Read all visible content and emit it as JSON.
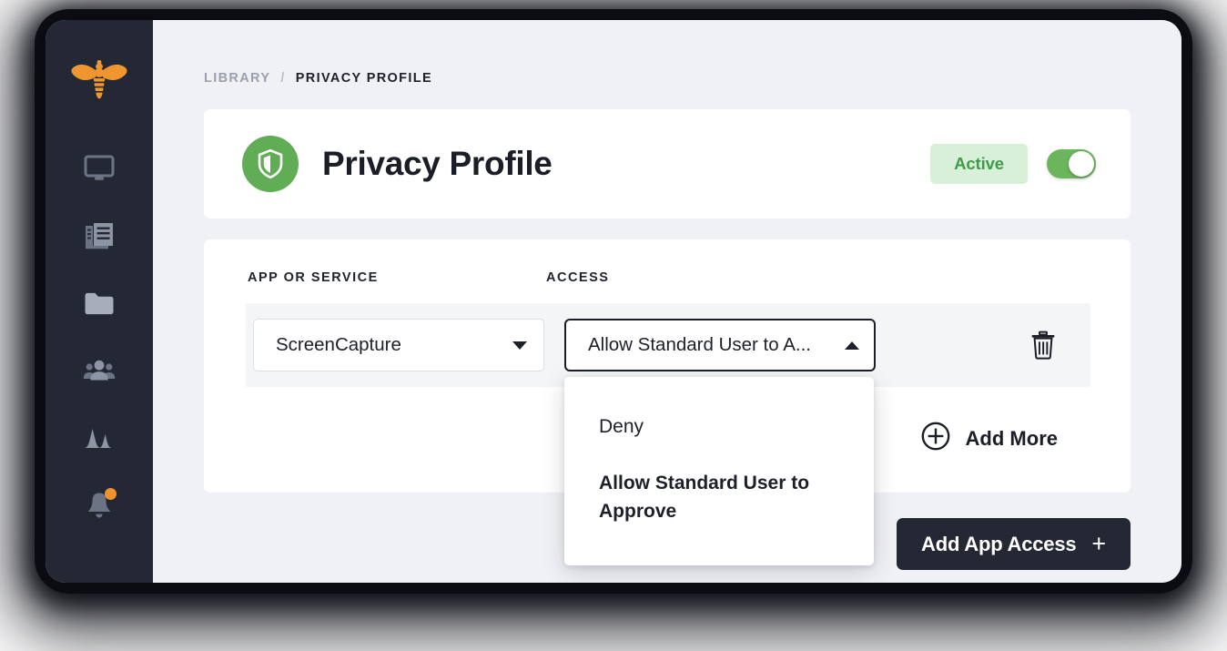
{
  "window": {
    "sidebar": {
      "logo_icon": "bee-logo",
      "items": [
        {
          "icon": "monitor-icon",
          "name": "devices"
        },
        {
          "icon": "documents-icon",
          "name": "library"
        },
        {
          "icon": "folder-icon",
          "name": "files"
        },
        {
          "icon": "people-icon",
          "name": "users"
        },
        {
          "icon": "activity-spikes-icon",
          "name": "activity"
        },
        {
          "icon": "bell-icon",
          "name": "notifications",
          "has_badge": true
        }
      ]
    },
    "breadcrumb": {
      "parent": "LIBRARY",
      "separator": "/",
      "current": "PRIVACY PROFILE"
    },
    "header_card": {
      "icon": "shield-icon",
      "icon_color": "#61ad55",
      "title": "Privacy Profile",
      "status_label": "Active",
      "status_bg": "#d9f0d8",
      "status_color": "#3f9b47",
      "toggle_on": true,
      "toggle_color": "#6bb65c"
    },
    "table": {
      "columns": {
        "app": "APP OR SERVICE",
        "access": "ACCESS"
      },
      "rows": [
        {
          "app_value": "ScreenCapture",
          "access_value": "Allow Standard User to A...",
          "access_expanded": true,
          "delete_icon": "trash-icon"
        }
      ],
      "access_options": [
        {
          "label": "Deny",
          "selected": false
        },
        {
          "label": "Allow Standard User to Approve",
          "selected": true
        }
      ],
      "add_more": {
        "icon": "plus-circle-icon",
        "label": "Add More"
      }
    },
    "footer": {
      "primary_button": {
        "label": "Add App Access",
        "icon": "plus-icon",
        "bg": "#232834"
      }
    }
  }
}
